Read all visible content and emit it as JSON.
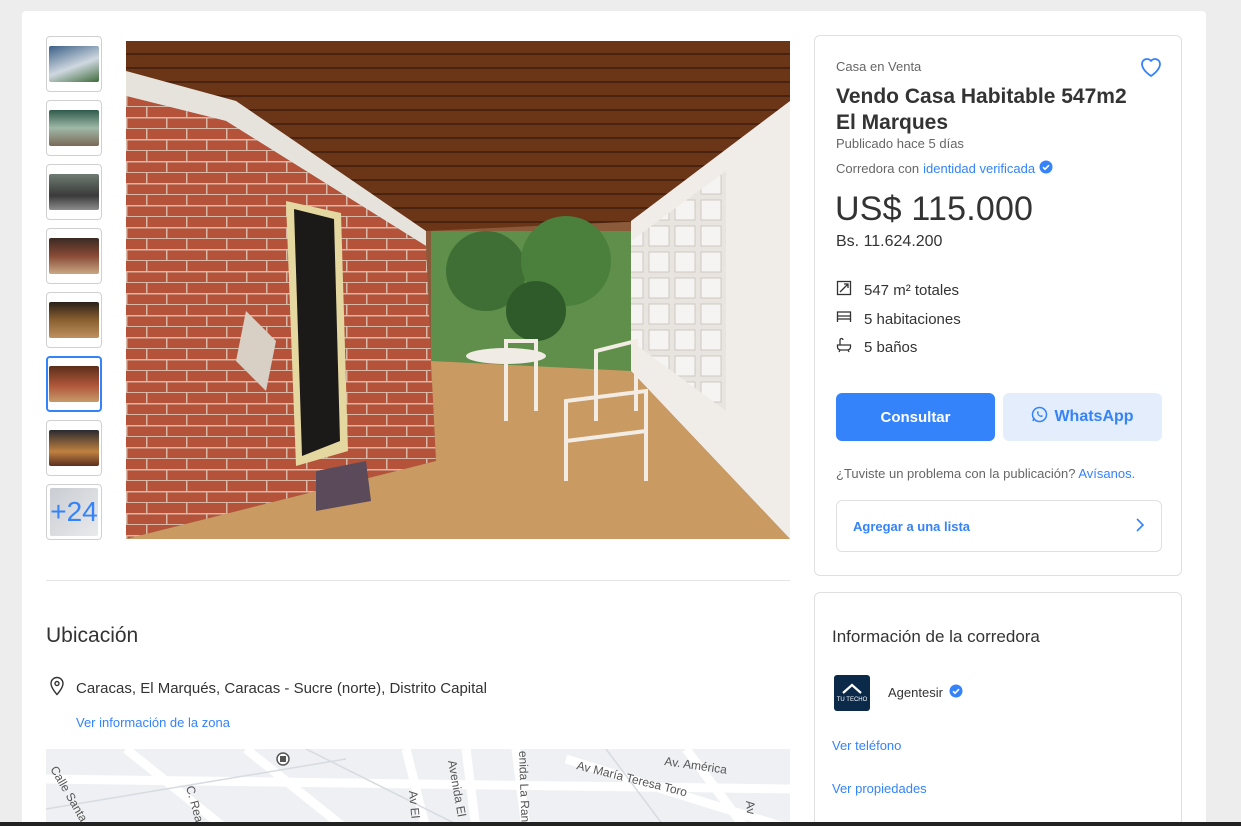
{
  "gallery": {
    "thumbs": [
      {
        "name": "thumb-1",
        "color": "#4a6b8a"
      },
      {
        "name": "thumb-2",
        "color": "#6f8f7a"
      },
      {
        "name": "thumb-3",
        "color": "#5c5c5c"
      },
      {
        "name": "thumb-4",
        "color": "#7a4a3a"
      },
      {
        "name": "thumb-5",
        "color": "#6b5030"
      },
      {
        "name": "thumb-6",
        "color": "#a5583a"
      },
      {
        "name": "thumb-7",
        "color": "#5a3a2a"
      }
    ],
    "more_label": "+24",
    "active_index": 5
  },
  "location": {
    "title": "Ubicación",
    "address": "Caracas, El Marqués, Caracas - Sucre (norte), Distrito Capital",
    "zone_link": "Ver información de la zona",
    "map_labels": [
      "Calle Santa R",
      "C. Rea",
      "Av El",
      "Avenida El",
      "enida La Ran",
      "Av. América",
      "Av María Teresa Toro",
      "Av"
    ]
  },
  "listing": {
    "category": "Casa en Venta",
    "title": "Vendo Casa Habitable 547m2 El Marques",
    "posted": "Publicado hace 5 días",
    "broker_prefix": "Corredora con",
    "broker_link": "identidad verificada",
    "price": "US$ 115.000",
    "price_local": "Bs. 11.624.200",
    "attributes": [
      {
        "icon": "area-icon",
        "label": "547 m² totales"
      },
      {
        "icon": "bed-icon",
        "label": "5 habitaciones"
      },
      {
        "icon": "bath-icon",
        "label": "5 baños"
      }
    ],
    "primary_button": "Consultar",
    "whatsapp_button": "WhatsApp",
    "problem_text": "¿Tuviste un problema con la publicación?",
    "problem_link": "Avísanos.",
    "add_list": "Agregar a una lista"
  },
  "broker": {
    "title": "Información de la corredora",
    "logo_text": "TU TECHO",
    "name": "Agentesir",
    "phone_link": "Ver teléfono",
    "properties_link": "Ver propiedades"
  },
  "colors": {
    "accent": "#3483fa",
    "whatsapp_bg": "#e3edfb",
    "page_bg": "#ededed"
  }
}
